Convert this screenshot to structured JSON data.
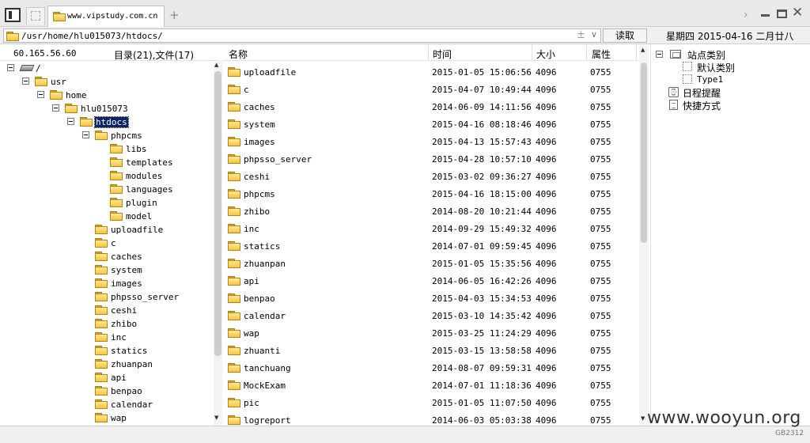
{
  "tabs": {
    "active_title": "www.vipstudy.com.cn",
    "new_tab_label": "+"
  },
  "window": {
    "next_label": "›"
  },
  "addressbar": {
    "path": "/usr/home/hlu015073/htdocs/",
    "clear_label": "±",
    "dropdown_label": "∨",
    "read_label": "读取",
    "date_text": "星期四 2015-04-16 二月廿八"
  },
  "left_panel": {
    "ip": "60.165.56.60",
    "dir_count": "目录(21),文件(17)",
    "tree": {
      "root": "/",
      "usr": "usr",
      "home": "home",
      "user": "hlu015073",
      "htdocs": "htdocs",
      "phpcms": "phpcms",
      "phpcms_children": [
        "libs",
        "templates",
        "modules",
        "languages",
        "plugin",
        "model"
      ],
      "htdocs_children": [
        "uploadfile",
        "c",
        "caches",
        "system",
        "images",
        "phpsso_server",
        "ceshi",
        "zhibo",
        "inc",
        "statics",
        "zhuanpan",
        "api",
        "benpao",
        "calendar",
        "wap"
      ]
    }
  },
  "file_list": {
    "headers": {
      "name": "名称",
      "time": "时间",
      "size": "大小",
      "attr": "属性"
    },
    "rows": [
      {
        "name": "uploadfile",
        "time": "2015-01-05 15:06:56",
        "size": "4096",
        "attr": "0755"
      },
      {
        "name": "c",
        "time": "2015-04-07 10:49:44",
        "size": "4096",
        "attr": "0755"
      },
      {
        "name": "caches",
        "time": "2014-06-09 14:11:56",
        "size": "4096",
        "attr": "0755"
      },
      {
        "name": "system",
        "time": "2015-04-16 08:18:46",
        "size": "4096",
        "attr": "0755"
      },
      {
        "name": "images",
        "time": "2015-04-13 15:57:43",
        "size": "4096",
        "attr": "0755"
      },
      {
        "name": "phpsso_server",
        "time": "2015-04-28 10:57:10",
        "size": "4096",
        "attr": "0755"
      },
      {
        "name": "ceshi",
        "time": "2015-03-02 09:36:27",
        "size": "4096",
        "attr": "0755"
      },
      {
        "name": "phpcms",
        "time": "2015-04-16 18:15:00",
        "size": "4096",
        "attr": "0755"
      },
      {
        "name": "zhibo",
        "time": "2014-08-20 10:21:44",
        "size": "4096",
        "attr": "0755"
      },
      {
        "name": "inc",
        "time": "2014-09-29 15:49:32",
        "size": "4096",
        "attr": "0755"
      },
      {
        "name": "statics",
        "time": "2014-07-01 09:59:45",
        "size": "4096",
        "attr": "0755"
      },
      {
        "name": "zhuanpan",
        "time": "2015-01-05 15:35:56",
        "size": "4096",
        "attr": "0755"
      },
      {
        "name": "api",
        "time": "2014-06-05 16:42:26",
        "size": "4096",
        "attr": "0755"
      },
      {
        "name": "benpao",
        "time": "2015-04-03 15:34:53",
        "size": "4096",
        "attr": "0755"
      },
      {
        "name": "calendar",
        "time": "2015-03-10 14:35:42",
        "size": "4096",
        "attr": "0755"
      },
      {
        "name": "wap",
        "time": "2015-03-25 11:24:29",
        "size": "4096",
        "attr": "0755"
      },
      {
        "name": "zhuanti",
        "time": "2015-03-15 13:58:58",
        "size": "4096",
        "attr": "0755"
      },
      {
        "name": "tanchuang",
        "time": "2014-08-07 09:59:31",
        "size": "4096",
        "attr": "0755"
      },
      {
        "name": "MockExam",
        "time": "2014-07-01 11:18:36",
        "size": "4096",
        "attr": "0755"
      },
      {
        "name": "pic",
        "time": "2015-01-05 11:07:50",
        "size": "4096",
        "attr": "0755"
      },
      {
        "name": "logreport",
        "time": "2014-06-03 05:03:38",
        "size": "4096",
        "attr": "0755"
      }
    ]
  },
  "right_panel": {
    "site_category": "站点类别",
    "default_category": "默认类别",
    "type1": "Type1",
    "schedule": "日程提醒",
    "shortcut": "快捷方式"
  },
  "footer": {
    "watermark": "www.wooyun.org",
    "encoding": "GB2312"
  }
}
